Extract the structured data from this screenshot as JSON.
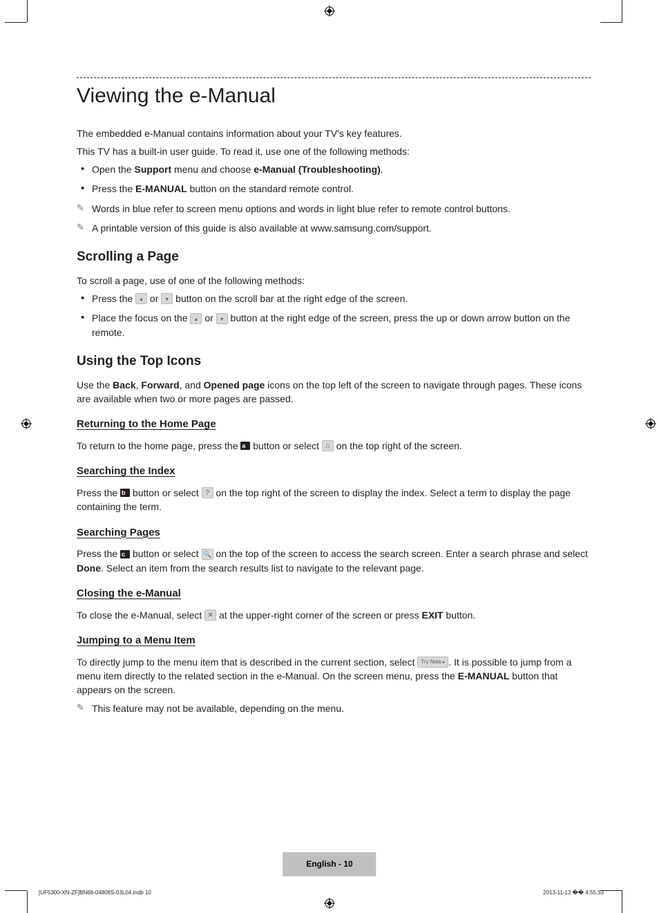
{
  "title": "Viewing the e-Manual",
  "intro": [
    "The embedded e-Manual contains information about your TV's key features.",
    "This TV has a built-in user guide. To read it, use one of the following methods:"
  ],
  "intro_bullets": [
    {
      "pre": "Open the ",
      "b1": "Support",
      "mid": " menu and choose ",
      "b2": "e-Manual (Troubleshooting)",
      "post": "."
    },
    {
      "pre": "Press the ",
      "b1": "E-MANUAL",
      "mid": " button on the standard remote control.",
      "b2": "",
      "post": ""
    }
  ],
  "intro_notes": [
    "Words in blue refer to screen menu options and words in light blue refer to remote control buttons.",
    "A printable version of this guide is also available at www.samsung.com/support."
  ],
  "scroll": {
    "heading": "Scrolling a Page",
    "lead": "To scroll a page, use of one of the following methods:",
    "b1_pre": "Press the ",
    "b1_mid": " or ",
    "b1_post": " button on the scroll bar at the right edge of the screen.",
    "b2_pre": "Place the focus on the ",
    "b2_mid": " or ",
    "b2_post": " button at the right edge of the screen, press the up or down arrow button on the remote."
  },
  "topicons": {
    "heading": "Using the Top Icons",
    "lead_pre": "Use the ",
    "back": "Back",
    "comma1": ", ",
    "forward": "Forward",
    "comma2": ", and ",
    "opened": "Opened page",
    "lead_post": " icons on the top left of the screen to navigate through pages. These icons are available when two or more pages are passed."
  },
  "home": {
    "heading": "Returning to the Home Page",
    "pre": "To return to the home page, press the ",
    "a_label": "a",
    "mid": " button or select ",
    "post": " on the top right of the screen."
  },
  "index": {
    "heading": "Searching the Index",
    "pre": "Press the ",
    "b_label": "b",
    "mid": " button or select ",
    "post": " on the top right of the screen to display the index. Select a term to display the page containing the term."
  },
  "search": {
    "heading": "Searching Pages",
    "pre": "Press the ",
    "c_label": "c",
    "mid": " button or select ",
    "post1": " on the top of the screen to access the search screen. Enter a search phrase and select ",
    "done": "Done",
    "post2": ". Select an item from the search results list to navigate to the relevant page."
  },
  "close": {
    "heading": "Closing the e-Manual",
    "pre": "To close the e-Manual, select ",
    "mid": " at the upper-right corner of the screen or press ",
    "exit": "EXIT",
    "post": " button."
  },
  "jump": {
    "heading": "Jumping to a Menu Item",
    "pre": "To directly jump to the menu item that is described in the current section, select ",
    "trynow": "Try Now",
    "mid": ". It is possible to jump from a menu item directly to the related section in the e-Manual. On the screen menu, press the ",
    "eman": "E-MANUAL",
    "post": " button that appears on the screen.",
    "note": "This feature may not be available, depending on the menu."
  },
  "footer": "English - 10",
  "print_left": "[UF5300-XN-ZF]BN68-04808S-03L04.indb   10",
  "print_right": "2013-11-13   �� 4:55:33"
}
